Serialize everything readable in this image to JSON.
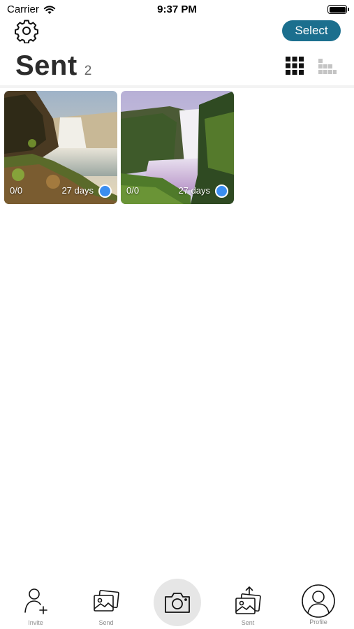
{
  "status_bar": {
    "carrier": "Carrier",
    "time": "9:37 PM",
    "icons": [
      "wifi-icon",
      "battery-icon"
    ]
  },
  "header": {
    "settings_icon": "gear-icon",
    "select_label": "Select",
    "title": "Sent",
    "count": "2",
    "view_grid_icon": "grid-3x3-icon",
    "view_compact_icon": "grid-compact-icon"
  },
  "photos": [
    {
      "views": "0/0",
      "age": "27 days",
      "subject": "waterfall-photo-1"
    },
    {
      "views": "0/0",
      "age": "27 days",
      "subject": "waterfall-photo-2"
    }
  ],
  "tabbar": {
    "invite_label": "Invite",
    "send_label": "Send",
    "sent_label": "Sent",
    "profile_label": "Profile",
    "camera_icon": "camera-icon"
  },
  "colors": {
    "accent": "#1b6f8e",
    "status_dot": "#3b8ef0",
    "title": "#2c2c2c",
    "tab_label": "#8a8a8a"
  }
}
